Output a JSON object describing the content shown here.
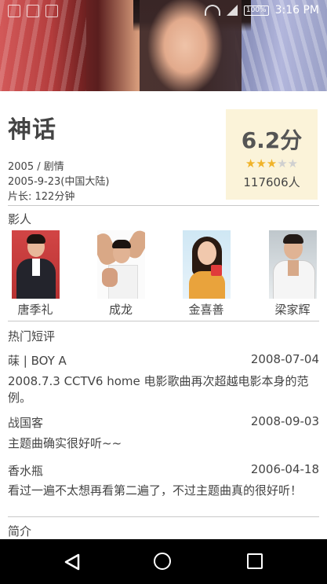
{
  "status_bar": {
    "battery": "100%",
    "time": "3:16 PM"
  },
  "movie": {
    "title": "神话",
    "year_genre": "2005 / 剧情",
    "release": "2005-9-23(中国大陆)",
    "runtime": "片长: 122分钟"
  },
  "rating": {
    "score_label": "6.2分",
    "stars_filled": 3,
    "stars_total": 5,
    "stars_on": "★★★",
    "stars_off": "★★",
    "raters": "117606人",
    "box_color": "#fbf3d9",
    "star_color": "#f0b32a"
  },
  "cast_section": {
    "heading": "影人",
    "members": [
      {
        "name": "唐季礼"
      },
      {
        "name": "成龙"
      },
      {
        "name": "金喜善"
      },
      {
        "name": "梁家辉"
      }
    ]
  },
  "reviews_section": {
    "heading": "热门短评",
    "items": [
      {
        "user": "菋 | BOY A",
        "date": "2008-07-04",
        "text": "2008.7.3 CCTV6 home 电影歌曲再次超越电影本身的范例。"
      },
      {
        "user": "战国客",
        "date": "2008-09-03",
        "text": "主题曲确实很好听~~"
      },
      {
        "user": "香水瓶",
        "date": "2006-04-18",
        "text": "看过一遍不太想再看第二遍了，不过主题曲真的很好听！"
      }
    ]
  },
  "synopsis_section": {
    "heading": "简介"
  },
  "nav": {
    "back_icon": "triangle-back",
    "home_icon": "circle-home",
    "recent_icon": "square-recents"
  }
}
